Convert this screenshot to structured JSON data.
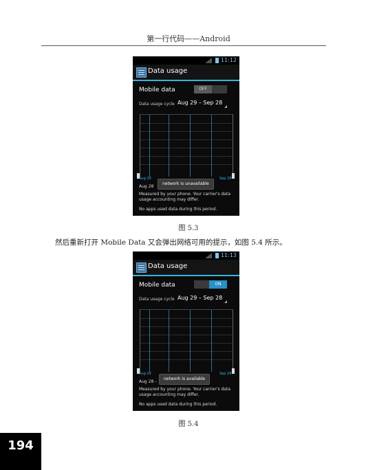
{
  "header": {
    "title": "第一行代码——Android"
  },
  "screens": [
    {
      "status_time": "11:12",
      "actionbar_title": "Data usage",
      "mobile_data_label": "Mobile data",
      "toggle_state": "OFF",
      "cycle_label": "Data usage cycle",
      "cycle_value": "Aug 29 – Sep 28",
      "graph_start": "Aug 29",
      "graph_end": "Sep 28",
      "date_row": "Aug 28",
      "toast": "network is unavailable",
      "measured_text": "Measured by your phone. Your carrier's data usage accounting may differ.",
      "no_apps_text": "No apps used data during this period.",
      "caption": "图    5.3"
    },
    {
      "status_time": "11:13",
      "actionbar_title": "Data usage",
      "mobile_data_label": "Mobile data",
      "toggle_state": "ON",
      "cycle_label": "Data usage cycle",
      "cycle_value": "Aug 29 – Sep 28",
      "graph_start": "Aug 29",
      "graph_end": "Sep 28",
      "date_row": "Aug 28 –",
      "toast": "network is available",
      "measured_text": "Measured by your phone. Your carrier's data usage accounting may differ.",
      "no_apps_text": "No apps used data during this period.",
      "caption": "图    5.4"
    }
  ],
  "body_text": "然后重新打开 Mobile Data 又会弹出网络可用的提示，如图 5.4 所示。",
  "page_number": "194",
  "colors": {
    "accent": "#33b5e5",
    "toggle_on": "#2c8fc7",
    "phone_bg": "#0b0b0b"
  }
}
